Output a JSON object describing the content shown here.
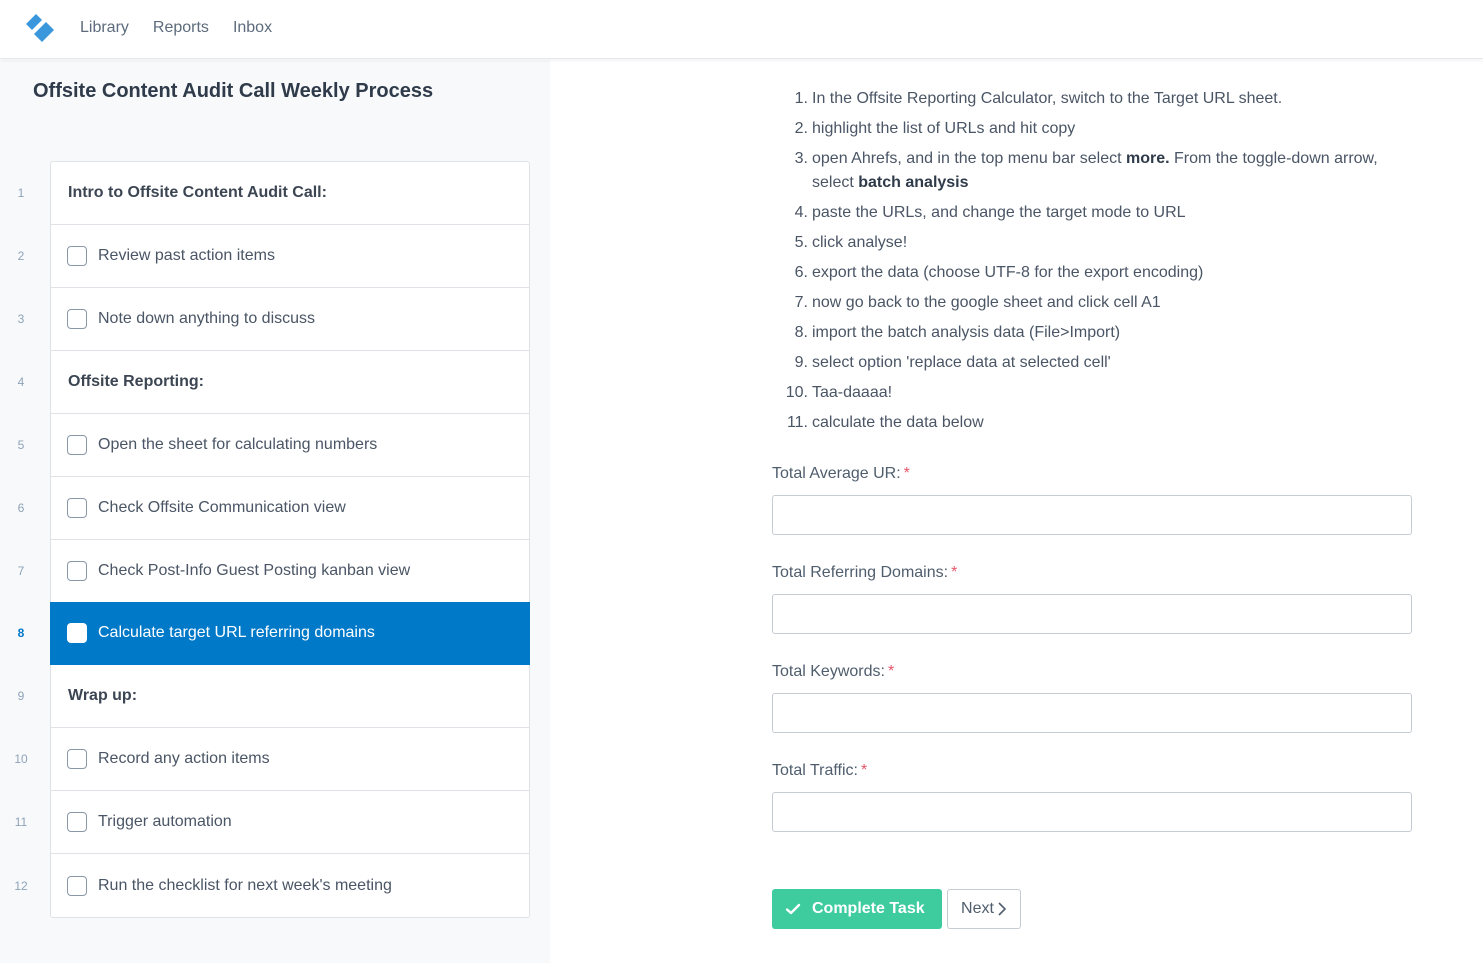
{
  "topbar": {
    "logo_icon": "app-logo-icon",
    "nav": [
      {
        "label": "Library"
      },
      {
        "label": "Reports"
      },
      {
        "label": "Inbox"
      }
    ]
  },
  "sidebar": {
    "title": "Offsite Content Audit Call Weekly Process",
    "tasks": [
      {
        "num": "1",
        "label": "Intro to Offsite Content Audit Call:",
        "type": "heading"
      },
      {
        "num": "2",
        "label": "Review past action items",
        "type": "task",
        "checked": false
      },
      {
        "num": "3",
        "label": "Note down anything to discuss",
        "type": "task",
        "checked": false
      },
      {
        "num": "4",
        "label": "Offsite Reporting:",
        "type": "heading"
      },
      {
        "num": "5",
        "label": "Open the sheet for calculating numbers",
        "type": "task",
        "checked": false
      },
      {
        "num": "6",
        "label": "Check Offsite Communication view",
        "type": "task",
        "checked": false
      },
      {
        "num": "7",
        "label": "Check Post-Info Guest Posting kanban view",
        "type": "task",
        "checked": false
      },
      {
        "num": "8",
        "label": "Calculate target URL referring domains",
        "type": "task",
        "checked": false,
        "active": true
      },
      {
        "num": "9",
        "label": "Wrap up:",
        "type": "heading"
      },
      {
        "num": "10",
        "label": "Record any action items",
        "type": "task",
        "checked": false
      },
      {
        "num": "11",
        "label": "Trigger automation",
        "type": "task",
        "checked": false
      },
      {
        "num": "12",
        "label": "Run the checklist for next week's meeting",
        "type": "task",
        "checked": false
      }
    ]
  },
  "main": {
    "steps": [
      {
        "n": "1.",
        "text": "In the Offsite Reporting Calculator, switch to the Target URL sheet."
      },
      {
        "n": "2.",
        "text": "highlight the list of URLs and hit copy"
      },
      {
        "n": "3.",
        "pre": "open Ahrefs, and in the top menu bar select ",
        "bold1": "more.",
        "mid": " From the toggle-down arrow, select ",
        "bold2": "batch analysis"
      },
      {
        "n": "4.",
        "text": "paste the URLs, and change the target mode to URL"
      },
      {
        "n": "5.",
        "text": "click analyse!"
      },
      {
        "n": "6.",
        "text": "export the data (choose UTF-8 for the export encoding)"
      },
      {
        "n": "7.",
        "text": "now go back to the google sheet and click cell A1"
      },
      {
        "n": "8.",
        "text": "import the batch analysis data (File>Import)"
      },
      {
        "n": "9.",
        "text": "select option 'replace data at selected cell'"
      },
      {
        "n": "10.",
        "text": "Taa-daaaa!"
      },
      {
        "n": "11.",
        "text": "calculate the data below"
      }
    ],
    "fields": [
      {
        "label": "Total Average UR:",
        "required_mark": "*",
        "value": "",
        "placeholder": ""
      },
      {
        "label": "Total Referring Domains:",
        "required_mark": "*",
        "value": "",
        "placeholder": ""
      },
      {
        "label": "Total Keywords:",
        "required_mark": "*",
        "value": "",
        "placeholder": ""
      },
      {
        "label": "Total Traffic:",
        "required_mark": "*",
        "value": "",
        "placeholder": ""
      }
    ],
    "complete_button": "Complete Task",
    "next_button": "Next"
  },
  "colors": {
    "accent_blue": "#0079c8",
    "complete_green": "#3ecc9f",
    "required_red": "#e5566b"
  }
}
